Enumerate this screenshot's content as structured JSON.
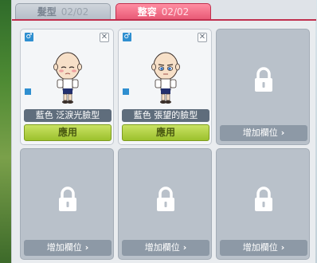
{
  "tabs": [
    {
      "label": "髮型",
      "count": "02/02",
      "active": false
    },
    {
      "label": "整容",
      "count": "02/02",
      "active": true
    }
  ],
  "colors": {
    "active_tab": "#e85a76",
    "apply_button": "#9cc12d",
    "name_bar": "#5f6d7c",
    "locked_slot": "#b9c1ca",
    "gender_male": "#2f8fd0"
  },
  "slots": [
    {
      "type": "face",
      "name": "藍色 泛淚光臉型",
      "apply_label": "應用",
      "gender": "♂",
      "close": "✕",
      "icon": "face-avatar"
    },
    {
      "type": "face",
      "name": "藍色 張望的臉型",
      "apply_label": "應用",
      "gender": "♂",
      "close": "✕",
      "icon": "face-avatar"
    },
    {
      "type": "locked",
      "add_label": "增加欄位",
      "chevron": "›",
      "icon": "lock-icon"
    },
    {
      "type": "locked",
      "add_label": "增加欄位",
      "chevron": "›",
      "icon": "lock-icon"
    },
    {
      "type": "locked",
      "add_label": "增加欄位",
      "chevron": "›",
      "icon": "lock-icon"
    },
    {
      "type": "locked",
      "add_label": "增加欄位",
      "chevron": "›",
      "icon": "lock-icon"
    }
  ]
}
